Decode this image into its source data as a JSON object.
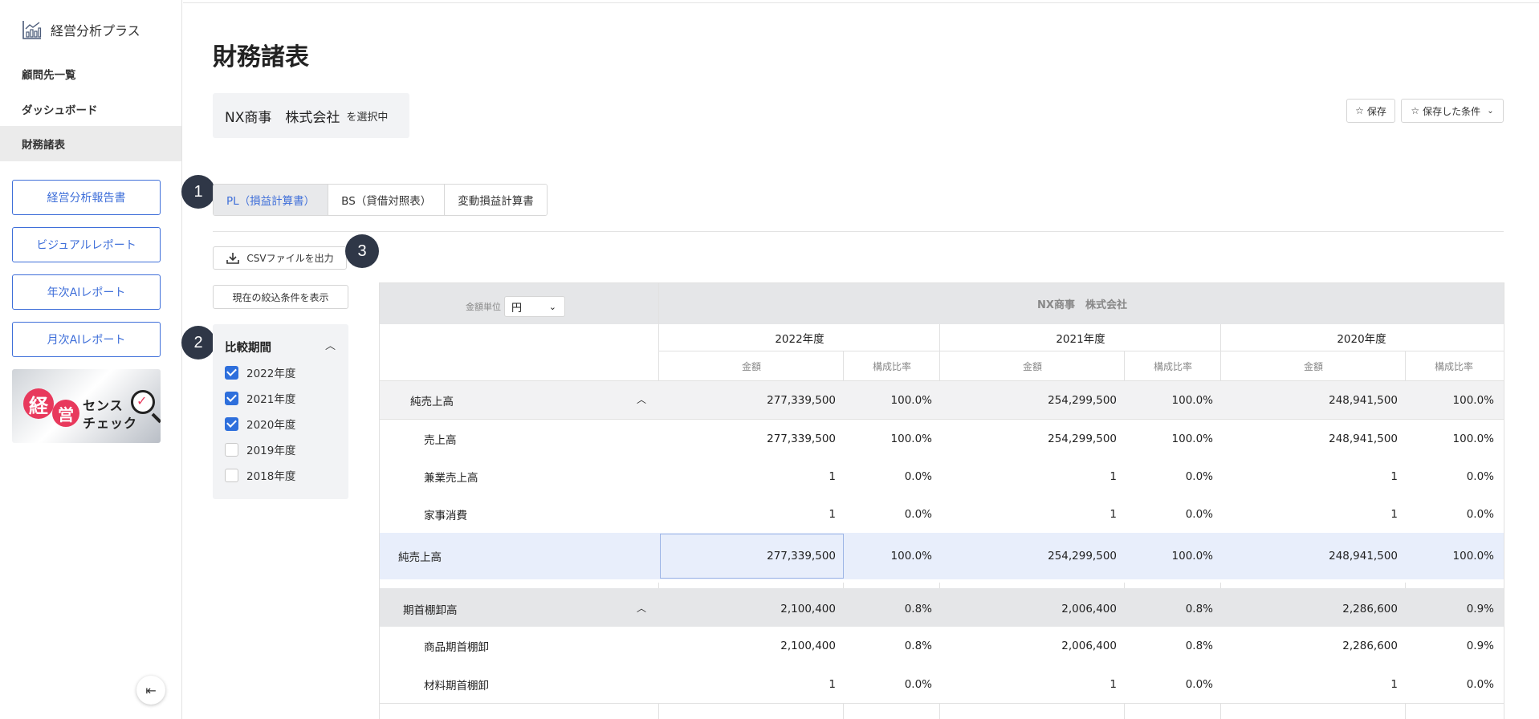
{
  "sidebar": {
    "app_name": "経営分析プラス",
    "nav": [
      {
        "label": "顧問先一覧"
      },
      {
        "label": "ダッシュボード"
      },
      {
        "label": "財務諸表"
      }
    ],
    "buttons": [
      {
        "label": "経営分析報告書"
      },
      {
        "label": "ビジュアルレポート"
      },
      {
        "label": "年次AIレポート"
      },
      {
        "label": "月次AIレポート"
      }
    ],
    "banner": {
      "c1": "経",
      "c2": "営",
      "line1": "センス",
      "line2": "チェック",
      "mark": "✓"
    },
    "collapse_icon": "⇤"
  },
  "page": {
    "title": "財務諸表",
    "company_name": "NX商事　株式会社",
    "selected_suffix": "を選択中",
    "save_label": "保存",
    "saved_conditions_label": "保存した条件",
    "tabs": [
      {
        "label": "PL（損益計算書）"
      },
      {
        "label": "BS（貸借対照表）"
      },
      {
        "label": "変動損益計算書"
      }
    ],
    "csv_label": "CSVファイルを出力",
    "show_filter_label": "現在の絞込条件を表示",
    "badges": [
      "1",
      "2",
      "3"
    ]
  },
  "filter": {
    "title": "比較期間",
    "options": [
      {
        "label": "2022年度",
        "checked": true
      },
      {
        "label": "2021年度",
        "checked": true
      },
      {
        "label": "2020年度",
        "checked": true
      },
      {
        "label": "2019年度",
        "checked": false
      },
      {
        "label": "2018年度",
        "checked": false
      }
    ]
  },
  "table": {
    "unit_label": "金額単位",
    "unit_value": "円",
    "company_header": "NX商事　株式会社",
    "years": [
      "2022年度",
      "2021年度",
      "2020年度"
    ],
    "amount_label": "金額",
    "ratio_label": "構成比率",
    "rows": [
      {
        "label": "純売上高",
        "type": "group",
        "values": [
          "277,339,500",
          "100.0%",
          "254,299,500",
          "100.0%",
          "248,941,500",
          "100.0%"
        ]
      },
      {
        "label": "売上高",
        "type": "child",
        "values": [
          "277,339,500",
          "100.0%",
          "254,299,500",
          "100.0%",
          "248,941,500",
          "100.0%"
        ]
      },
      {
        "label": "兼業売上高",
        "type": "child",
        "values": [
          "1",
          "0.0%",
          "1",
          "0.0%",
          "1",
          "0.0%"
        ]
      },
      {
        "label": "家事消費",
        "type": "child",
        "values": [
          "1",
          "0.0%",
          "1",
          "0.0%",
          "1",
          "0.0%"
        ]
      },
      {
        "label": "純売上高",
        "type": "total",
        "values": [
          "277,339,500",
          "100.0%",
          "254,299,500",
          "100.0%",
          "248,941,500",
          "100.0%"
        ]
      },
      {
        "label": "期首棚卸高",
        "type": "group2",
        "values": [
          "2,100,400",
          "0.8%",
          "2,006,400",
          "0.8%",
          "2,286,600",
          "0.9%"
        ]
      },
      {
        "label": "商品期首棚卸",
        "type": "child",
        "values": [
          "2,100,400",
          "0.8%",
          "2,006,400",
          "0.8%",
          "2,286,600",
          "0.9%"
        ]
      },
      {
        "label": "材料期首棚卸",
        "type": "child",
        "values": [
          "1",
          "0.0%",
          "1",
          "0.0%",
          "1",
          "0.0%"
        ]
      }
    ]
  }
}
